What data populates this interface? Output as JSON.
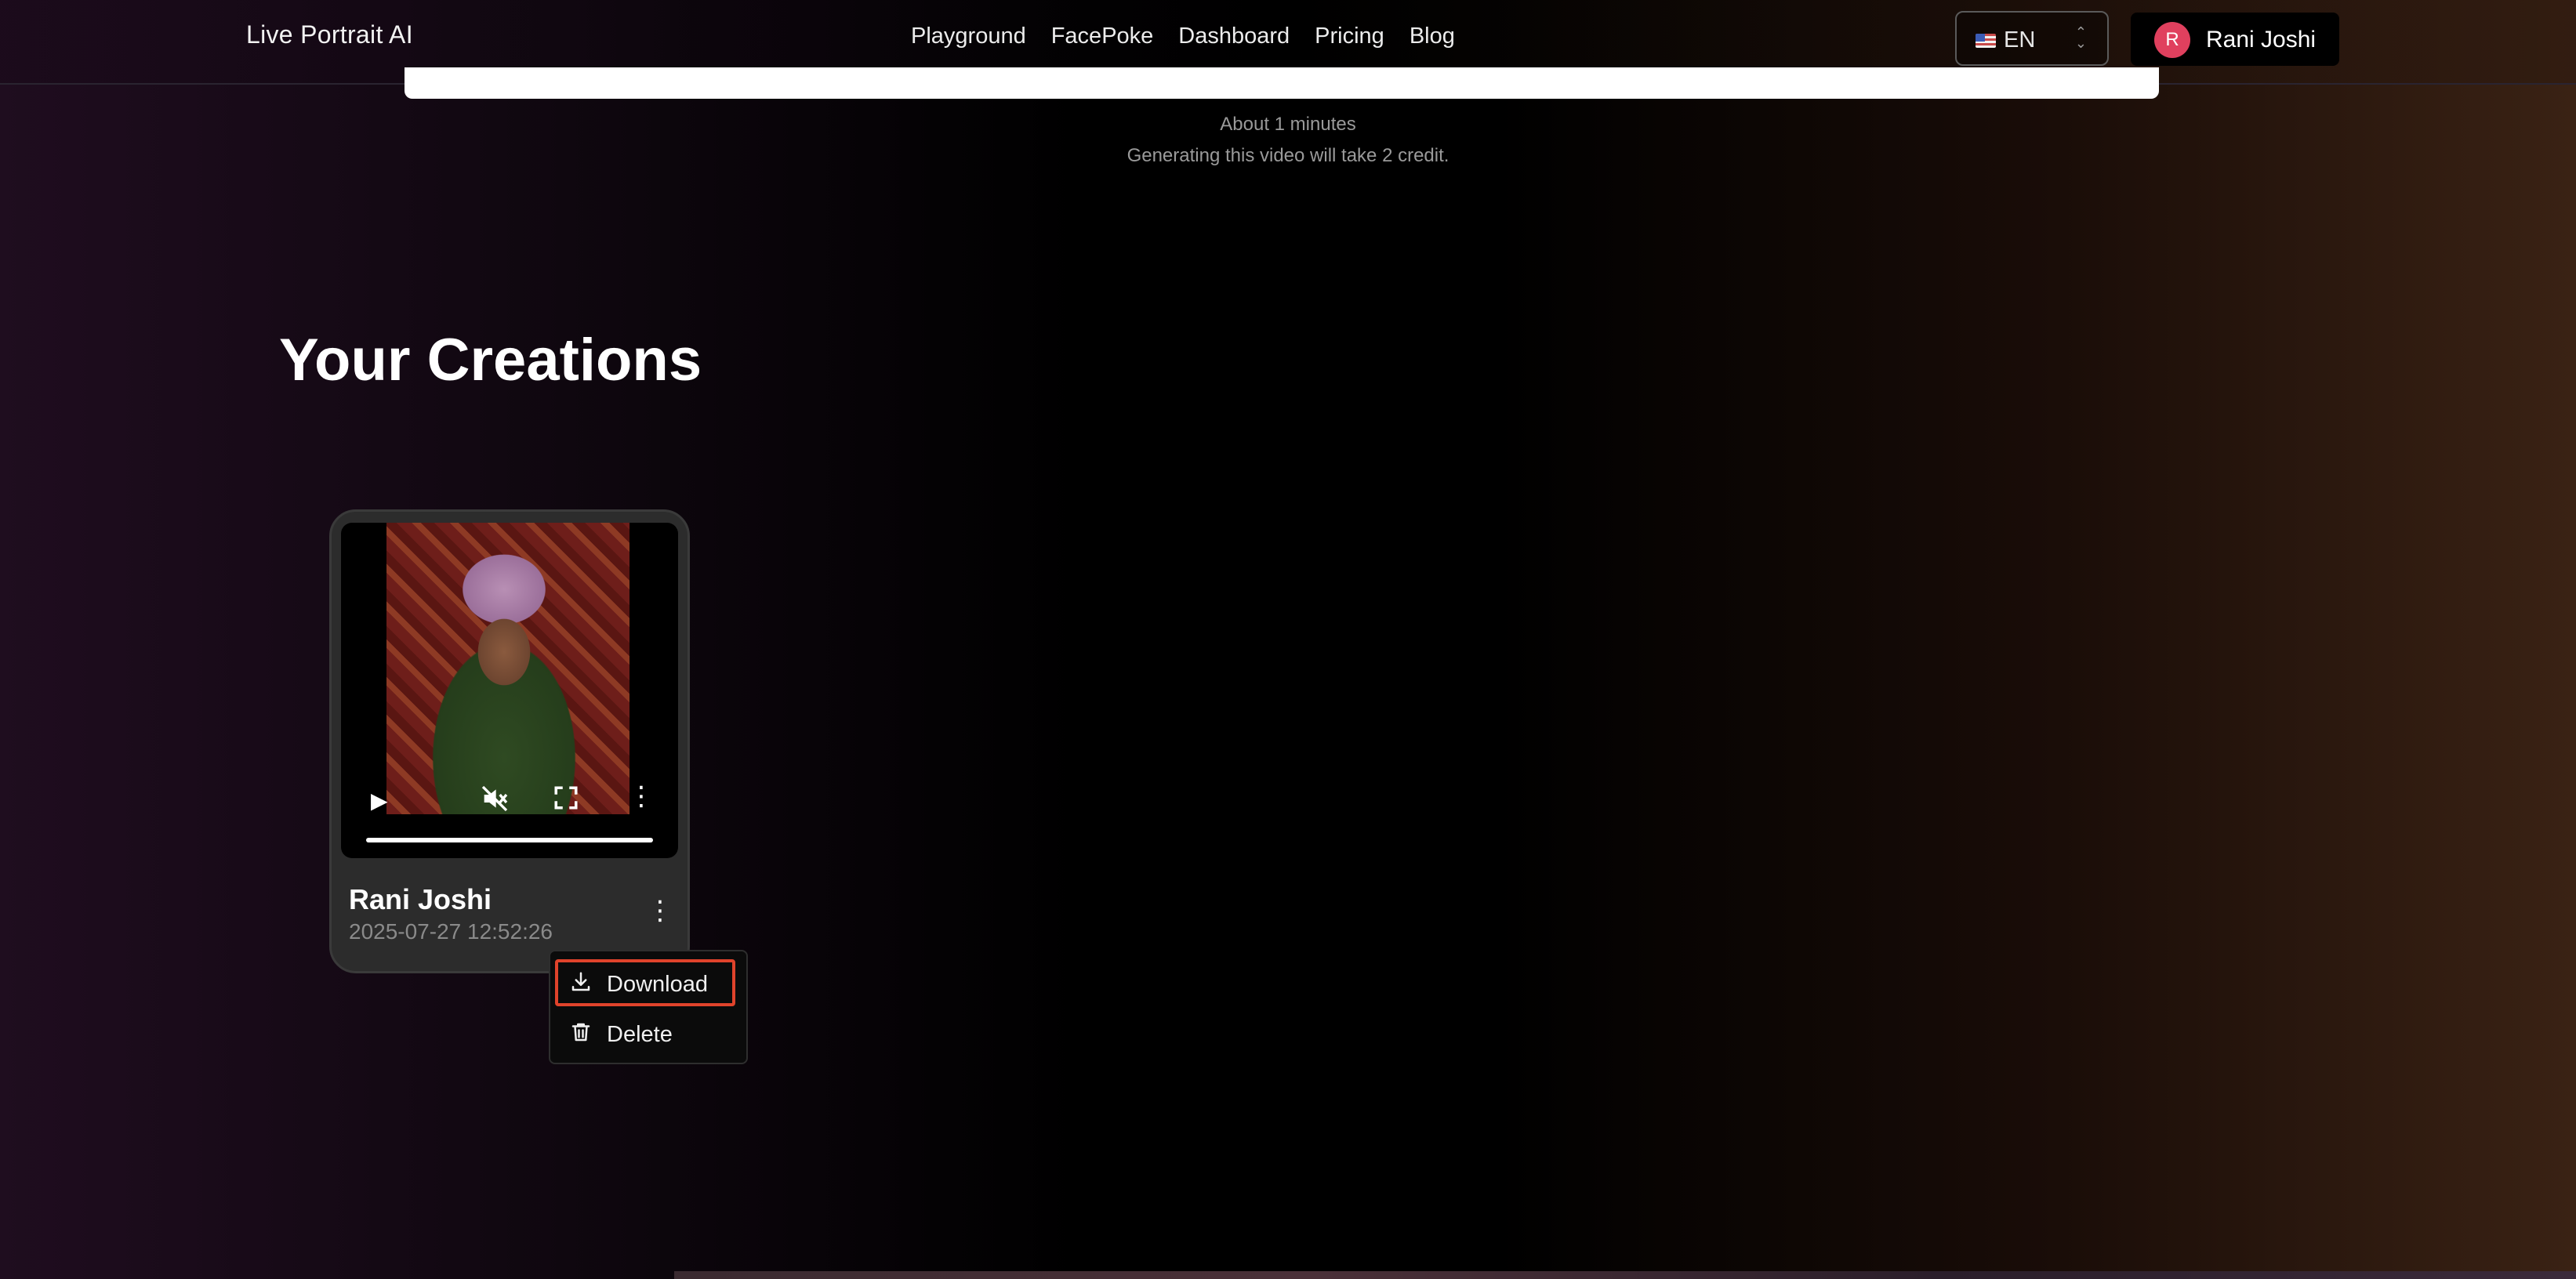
{
  "nav": {
    "brand": "Live Portrait AI",
    "links": [
      "Playground",
      "FacePoke",
      "Dashboard",
      "Pricing",
      "Blog"
    ],
    "language": "EN",
    "user": {
      "initial": "R",
      "name": "Rani Joshi"
    }
  },
  "generator": {
    "time_estimate": "About 1 minutes",
    "credit_note": "Generating this video will take 2 credit."
  },
  "creations": {
    "title": "Your Creations",
    "items": [
      {
        "name": "Rani Joshi",
        "date": "2025-07-27 12:52:26"
      }
    ]
  },
  "context_menu": {
    "items": [
      {
        "label": "Download",
        "icon": "download-icon"
      },
      {
        "label": "Delete",
        "icon": "trash-icon"
      }
    ]
  },
  "colors": {
    "highlight": "#e0432b",
    "avatar": "#e0405e"
  }
}
